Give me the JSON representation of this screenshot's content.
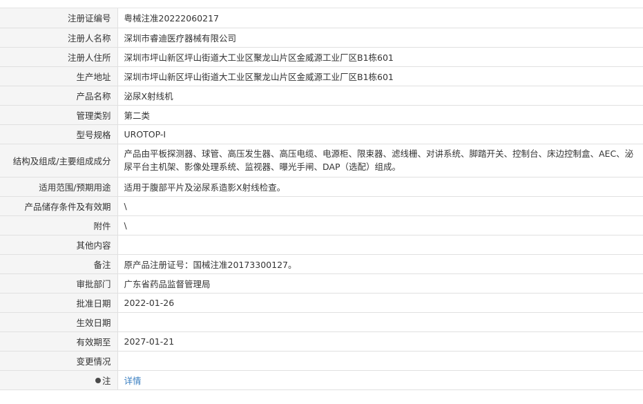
{
  "rows": [
    {
      "label": "注册证编号",
      "value": "粤械注准20222060217"
    },
    {
      "label": "注册人名称",
      "value": "深圳市睿迪医疗器械有限公司"
    },
    {
      "label": "注册人住所",
      "value": "深圳市坪山新区坪山街道大工业区聚龙山片区金威源工业厂区B1栋601"
    },
    {
      "label": "生产地址",
      "value": "深圳市坪山新区坪山街道大工业区聚龙山片区金威源工业厂区B1栋601"
    },
    {
      "label": "产品名称",
      "value": "泌尿X射线机"
    },
    {
      "label": "管理类别",
      "value": "第二类"
    },
    {
      "label": "型号规格",
      "value": "UROTOP-I"
    },
    {
      "label": "结构及组成/主要组成成分",
      "value": "产品由平板探测器、球管、高压发生器、高压电缆、电源柜、限束器、滤线栅、对讲系统、脚踏开关、控制台、床边控制盒、AEC、泌尿平台主机架、影像处理系统、监视器、曝光手闸、DAP（选配）组成。"
    },
    {
      "label": "适用范围/预期用途",
      "value": "适用于腹部平片及泌尿系造影X射线检查。"
    },
    {
      "label": "产品储存条件及有效期",
      "value": "\\"
    },
    {
      "label": "附件",
      "value": "\\"
    },
    {
      "label": "其他内容",
      "value": ""
    },
    {
      "label": "备注",
      "value": "原产品注册证号：国械注准20173300127。"
    },
    {
      "label": "审批部门",
      "value": "广东省药品监督管理局"
    },
    {
      "label": "批准日期",
      "value": "2022-01-26"
    },
    {
      "label": "生效日期",
      "value": ""
    },
    {
      "label": "有效期至",
      "value": "2027-01-21"
    },
    {
      "label": "变更情况",
      "value": ""
    },
    {
      "label": "注",
      "value": "详情",
      "icon": "pin-icon"
    }
  ],
  "colors": {
    "label_bg": "#f5f5f5",
    "border": "#e0e0e0",
    "link": "#3a7fc1",
    "text": "#333333"
  }
}
